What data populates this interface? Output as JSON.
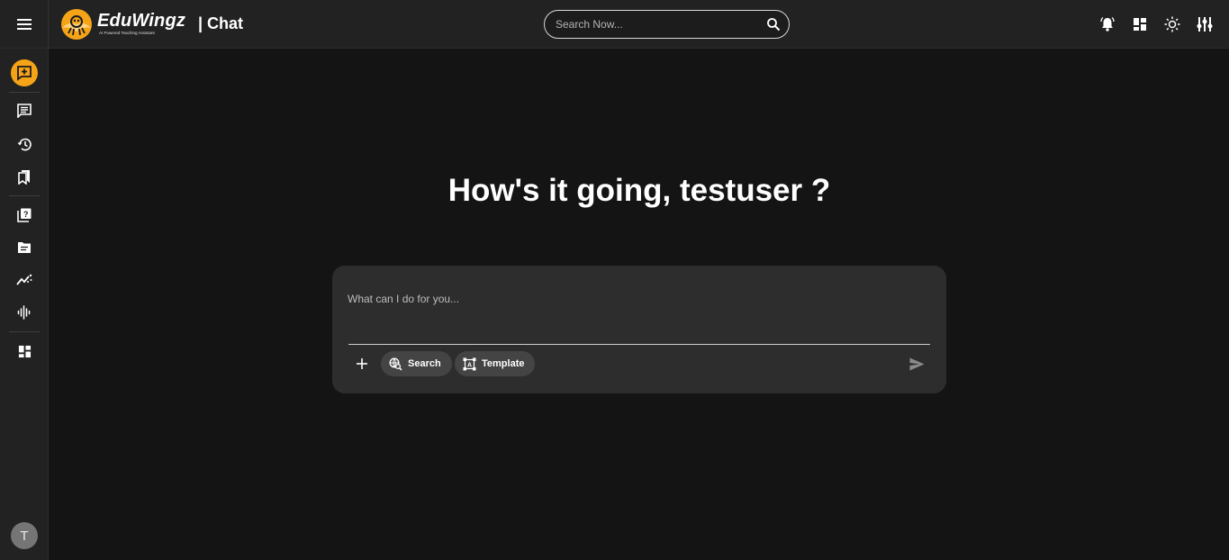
{
  "header": {
    "brand_name": "EduWingz",
    "brand_tagline": "AI Powered Teaching Assistant",
    "page_title": "| Chat",
    "search_placeholder": "Search Now...",
    "search_value": ""
  },
  "icons": {
    "menu": "menu-icon",
    "search": "search-icon",
    "notifications": "bell-icon",
    "dashboard": "dashboard-icon",
    "theme": "sun-icon",
    "settings": "equalizer-icon"
  },
  "sidebar": {
    "items": [
      {
        "name": "new-chat",
        "icon": "add-chat-icon",
        "active": true
      },
      {
        "name": "chats",
        "icon": "chat-icon",
        "active": false
      },
      {
        "name": "history",
        "icon": "history-icon",
        "active": false
      },
      {
        "name": "bookmarks",
        "icon": "bookmarks-icon",
        "active": false
      },
      {
        "name": "quiz",
        "icon": "question-book-icon",
        "active": false
      },
      {
        "name": "documents",
        "icon": "folder-icon",
        "active": false
      },
      {
        "name": "analytics",
        "icon": "trending-icon",
        "active": false
      },
      {
        "name": "audio",
        "icon": "waveform-icon",
        "active": false
      },
      {
        "name": "dashboard",
        "icon": "dashboard-icon",
        "active": false
      }
    ],
    "avatar_initial": "T"
  },
  "main": {
    "greeting": "How's it going, testuser ?",
    "composer": {
      "placeholder": "What can I do for you...",
      "value": "",
      "search_label": "Search",
      "template_label": "Template"
    }
  },
  "colors": {
    "accent": "#f5a418",
    "background": "#141414",
    "surface": "#222222",
    "composer": "#2d2d2d",
    "chip": "#444444"
  }
}
